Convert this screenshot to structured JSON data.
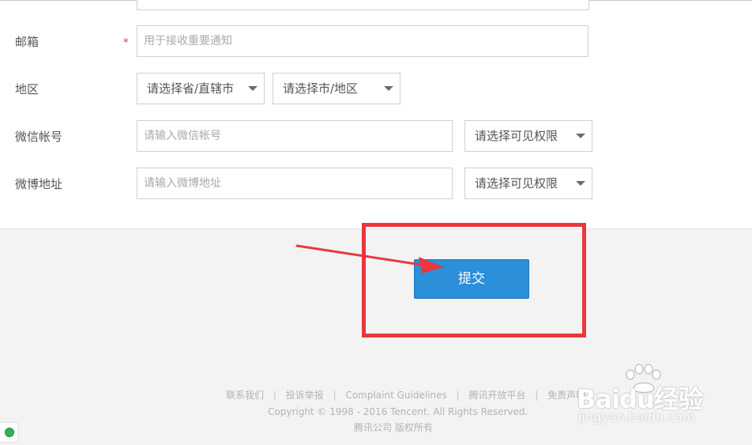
{
  "form": {
    "email": {
      "label": "邮箱",
      "required_mark": "*",
      "placeholder": "用于接收重要通知"
    },
    "region": {
      "label": "地区",
      "province_select": "请选择省/直辖市",
      "city_select": "请选择市/地区"
    },
    "wechat": {
      "label": "微信帐号",
      "placeholder": "请输入微信帐号",
      "visibility_select": "请选择可见权限"
    },
    "weibo": {
      "label": "微博地址",
      "placeholder": "请输入微博地址",
      "visibility_select": "请选择可见权限"
    }
  },
  "submit": {
    "label": "提交"
  },
  "footer": {
    "links": [
      "联系我们",
      "投诉举报",
      "Complaint Guidelines",
      "腾讯开放平台",
      "免责声明"
    ],
    "separator": "|",
    "copyright": "Copyright © 1998 - 2016 Tencent. All Rights Reserved.",
    "company": "腾讯公司 版权所有"
  },
  "watermark": {
    "brand": "Baidu经验",
    "url": "jingyan.baidu.com"
  },
  "colors": {
    "primary_button": "#2b8fd9",
    "annotation_red": "#e8373d",
    "required_star": "#e23a3a"
  },
  "icons": {
    "select_arrow": "triangle-down",
    "status_dot": "green-circle"
  }
}
